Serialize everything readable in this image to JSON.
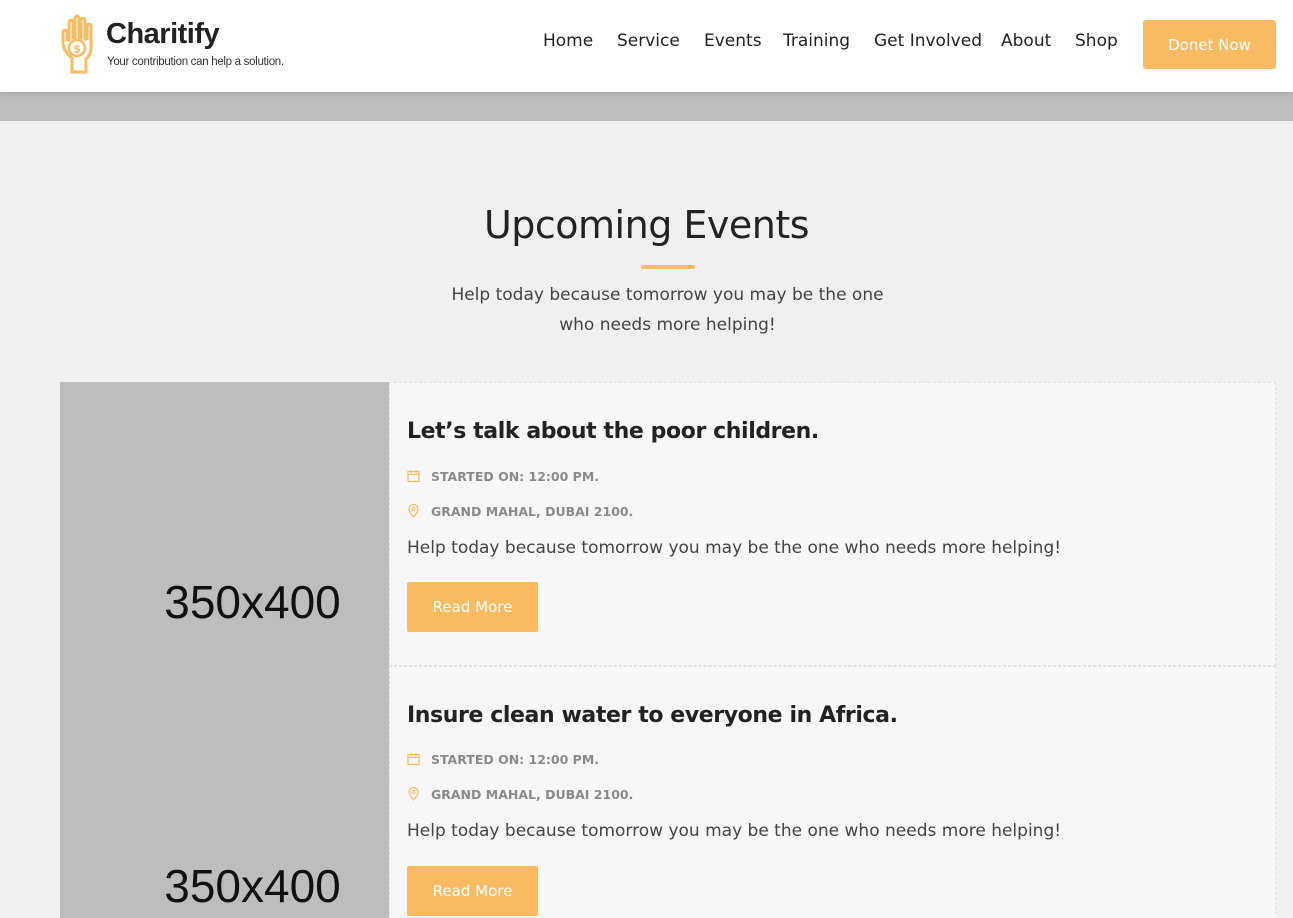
{
  "brand": {
    "name": "Charitify",
    "tagline": "Your contribution can help a solution.",
    "logo_icon": "hand-coin-icon",
    "accent_color": "#f8bb62"
  },
  "nav": {
    "items": [
      "Home",
      "Service",
      "Events",
      "Training",
      "Get Involved",
      "About",
      "Shop"
    ],
    "donate_label": "Donet Now"
  },
  "section": {
    "title": "Upcoming Events",
    "subtitle": "Help today because tomorrow you may be the one who needs more helping!"
  },
  "events": [
    {
      "image_label": "350x400",
      "title": "Let’s talk about the poor children.",
      "time": "Started On: 12:00 pm.",
      "location": "Grand Mahal, Dubai 2100.",
      "description": "Help today because tomorrow you may be the one who needs more helping!",
      "button_label": "Read More"
    },
    {
      "image_label": "350x400",
      "title": "Insure clean water to everyone in Africa.",
      "time": "Started On: 12:00 pm.",
      "location": "Grand Mahal, Dubai 2100.",
      "description": "Help today because tomorrow you may be the one who needs more helping!",
      "button_label": "Read More"
    }
  ],
  "icons": {
    "time": "calendar-icon",
    "location": "map-pin-icon"
  }
}
